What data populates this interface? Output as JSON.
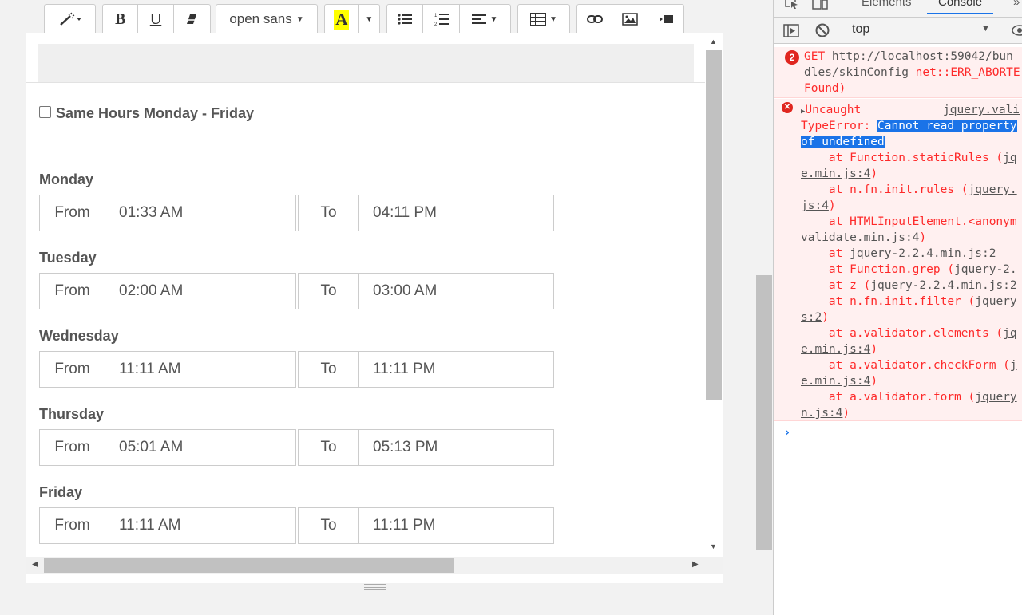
{
  "toolbar": {
    "font_name": "open sans",
    "highlight_letter": "A",
    "bold": "B",
    "underline": "U"
  },
  "form": {
    "same_hours_label": "Same Hours Monday - Friday",
    "from_label": "From",
    "to_label": "To",
    "days": [
      {
        "name": "Monday",
        "from": "01:33 AM",
        "to": "04:11 PM"
      },
      {
        "name": "Tuesday",
        "from": "02:00 AM",
        "to": "03:00 AM"
      },
      {
        "name": "Wednesday",
        "from": "11:11 AM",
        "to": "11:11 PM"
      },
      {
        "name": "Thursday",
        "from": "05:01 AM",
        "to": "05:13 PM"
      },
      {
        "name": "Friday",
        "from": "11:11 AM",
        "to": "11:11 PM"
      }
    ]
  },
  "devtools": {
    "tabs": [
      "Elements",
      "Console"
    ],
    "active_tab": "Console",
    "more": "»",
    "context": "top",
    "error_count": "2",
    "get_msg": {
      "line1_prefix": "GET ",
      "line1_link": "http://localhost:59042/bun",
      "line2_link": "dles/skinConfig",
      "line2_rest": " net::ERR_ABORTE",
      "line3": "Found)"
    },
    "uncaught": {
      "label": "Uncaught",
      "source": "jquery.vali",
      "type_prefix": "TypeError: ",
      "selected_1": "Cannot read property",
      "selected_2": "of undefined",
      "stack": [
        {
          "text": "    at Function.staticRules (",
          "link": "jq"
        },
        {
          "text": "",
          "link": "e.min.js:4",
          "tail": ")"
        },
        {
          "text": "    at n.fn.init.rules (",
          "link": "jquery."
        },
        {
          "text": "",
          "link": "js:4",
          "tail": ")"
        },
        {
          "text": "    at HTMLInputElement.<anonym",
          "link": ""
        },
        {
          "text": "",
          "link": "validate.min.js:4",
          "tail": ")"
        },
        {
          "text": "    at ",
          "link": "jquery-2.2.4.min.js:2"
        },
        {
          "text": "    at Function.grep (",
          "link": "jquery-2."
        },
        {
          "text": "    at z (",
          "link": "jquery-2.2.4.min.js:2"
        },
        {
          "text": "    at n.fn.init.filter (",
          "link": "jquery"
        },
        {
          "text": "",
          "link": "s:2",
          "tail": ")"
        },
        {
          "text": "    at a.validator.elements (",
          "link": "jq"
        },
        {
          "text": "",
          "link": "e.min.js:4",
          "tail": ")"
        },
        {
          "text": "    at a.validator.checkForm (",
          "link": "j"
        },
        {
          "text": "",
          "link": "e.min.js:4",
          "tail": ")"
        },
        {
          "text": "    at a.validator.form (",
          "link": "jquery"
        },
        {
          "text": "",
          "link": "n.js:4",
          "tail": ")"
        }
      ]
    },
    "prompt": "›"
  }
}
